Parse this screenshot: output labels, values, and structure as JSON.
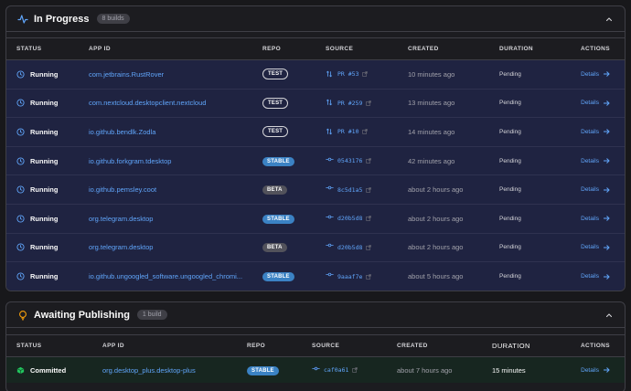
{
  "in_progress": {
    "title": "In Progress",
    "count": "8 builds",
    "columns": {
      "status": "STATUS",
      "app_id": "APP ID",
      "repo": "REPO",
      "source": "SOURCE",
      "created": "CREATED",
      "duration": "DURATION",
      "actions": "ACTIONS"
    },
    "rows": [
      {
        "status": "Running",
        "app_id": "com.jetbrains.RustRover",
        "repo": "TEST",
        "repo_kind": "test",
        "source_kind": "pr",
        "source": "PR #53",
        "created": "10 minutes ago",
        "duration": "Pending",
        "action": "Details"
      },
      {
        "status": "Running",
        "app_id": "com.nextcloud.desktopclient.nextcloud",
        "repo": "TEST",
        "repo_kind": "test",
        "source_kind": "pr",
        "source": "PR #259",
        "created": "13 minutes ago",
        "duration": "Pending",
        "action": "Details"
      },
      {
        "status": "Running",
        "app_id": "io.github.bendlk.Zodla",
        "repo": "TEST",
        "repo_kind": "test",
        "source_kind": "pr",
        "source": "PR #10",
        "created": "14 minutes ago",
        "duration": "Pending",
        "action": "Details"
      },
      {
        "status": "Running",
        "app_id": "io.github.forkgram.tdesktop",
        "repo": "STABLE",
        "repo_kind": "stable",
        "source_kind": "commit",
        "source": "0543176",
        "created": "42 minutes ago",
        "duration": "Pending",
        "action": "Details"
      },
      {
        "status": "Running",
        "app_id": "io.github.pemsley.coot",
        "repo": "BETA",
        "repo_kind": "beta",
        "source_kind": "commit",
        "source": "8c5d1a5",
        "created": "about 2 hours ago",
        "duration": "Pending",
        "action": "Details"
      },
      {
        "status": "Running",
        "app_id": "org.telegram.desktop",
        "repo": "STABLE",
        "repo_kind": "stable",
        "source_kind": "commit",
        "source": "d20b5d8",
        "created": "about 2 hours ago",
        "duration": "Pending",
        "action": "Details"
      },
      {
        "status": "Running",
        "app_id": "org.telegram.desktop",
        "repo": "BETA",
        "repo_kind": "beta",
        "source_kind": "commit",
        "source": "d20b5d8",
        "created": "about 2 hours ago",
        "duration": "Pending",
        "action": "Details"
      },
      {
        "status": "Running",
        "app_id": "io.github.ungoogled_software.ungoogled_chromi...",
        "repo": "STABLE",
        "repo_kind": "stable",
        "source_kind": "commit",
        "source": "9aaaf7e",
        "created": "about 5 hours ago",
        "duration": "Pending",
        "action": "Details"
      }
    ]
  },
  "awaiting": {
    "title": "Awaiting Publishing",
    "count": "1 build",
    "columns": {
      "status": "STATUS",
      "app_id": "APP ID",
      "repo": "REPO",
      "source": "SOURCE",
      "created": "CREATED",
      "duration": "DURATION",
      "actions": "ACTIONS"
    },
    "rows": [
      {
        "status": "Committed",
        "app_id": "org.desktop_plus.desktop-plus",
        "repo": "STABLE",
        "repo_kind": "stable",
        "source_kind": "commit",
        "source": "caf0a61",
        "created": "about 7 hours ago",
        "duration": "15 minutes",
        "action": "Details"
      }
    ]
  },
  "colors": {
    "accent": "#60a5fa",
    "running_row": "#1f2341",
    "committed_row": "#172620",
    "stable": "#3b82c4",
    "beta": "#52525b"
  },
  "icons": {
    "in_progress": "activity-icon",
    "awaiting": "bulb-icon",
    "running": "clock-icon",
    "committed": "cube-icon",
    "pr": "pull-request-icon",
    "commit": "commit-icon",
    "external": "external-link-icon",
    "details": "arrow-right-icon",
    "collapse": "chevron-up-icon"
  }
}
